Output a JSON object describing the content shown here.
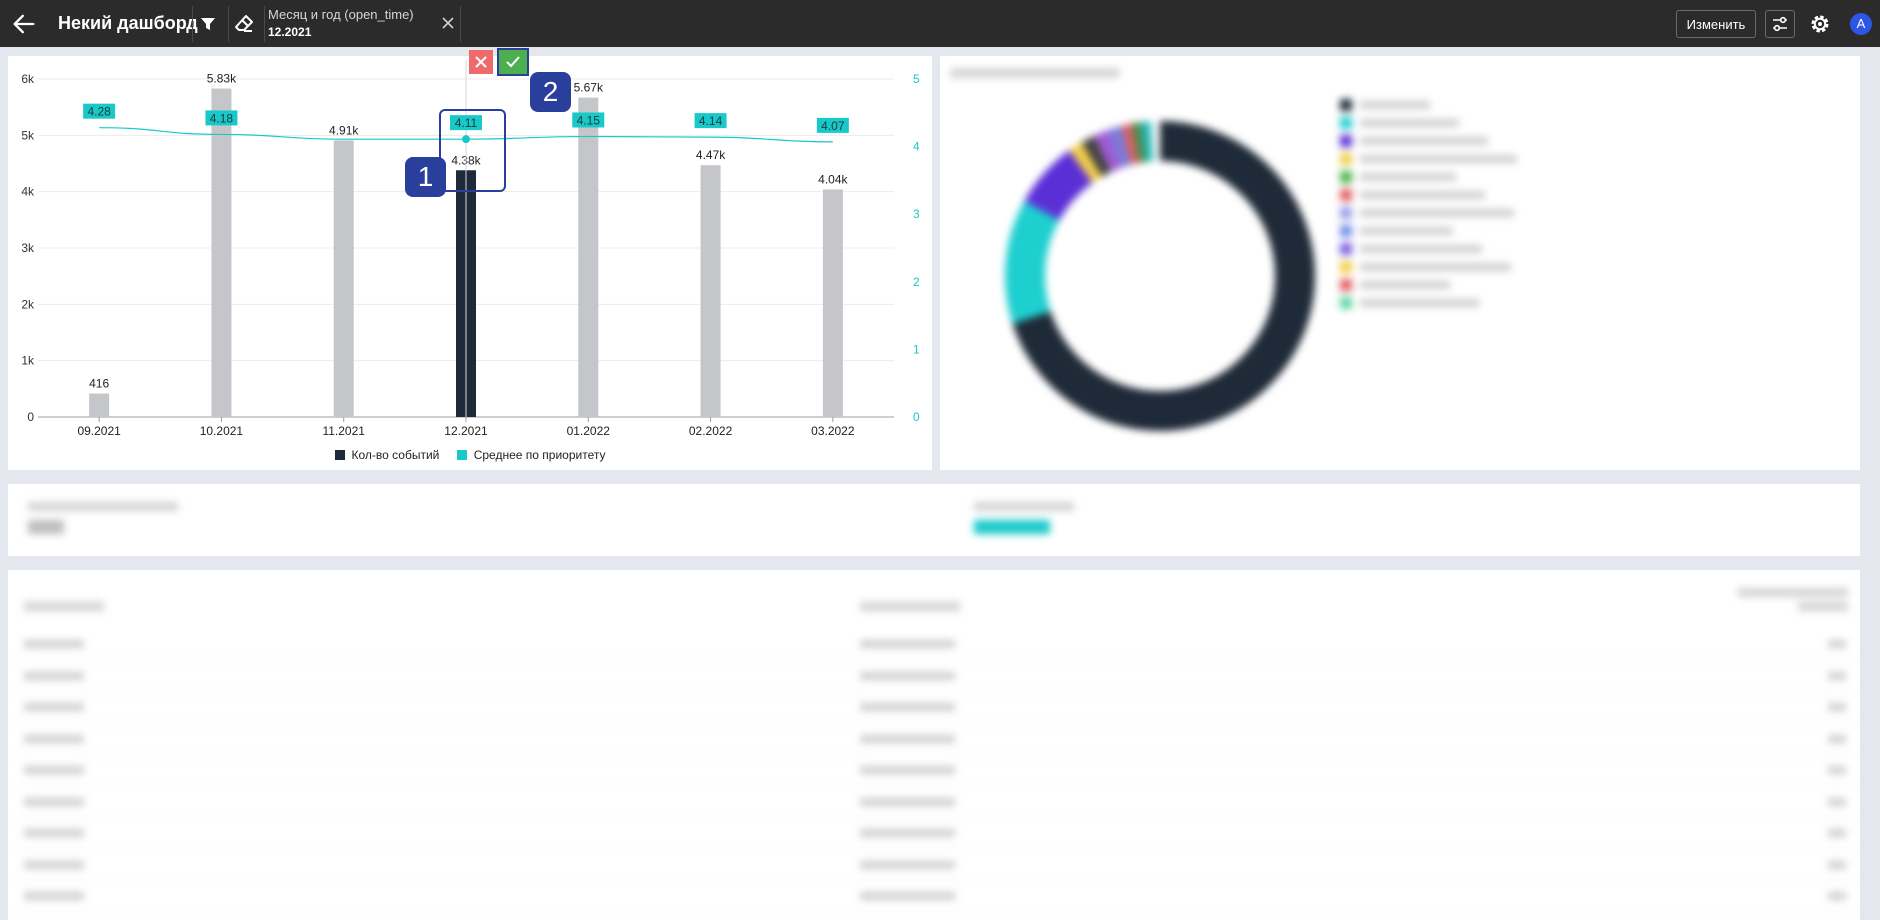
{
  "header": {
    "dashboard_title": "Некий дашборд",
    "filter": {
      "name": "Месяц и год (open_time)",
      "value": "12.2021"
    },
    "edit_label": "Изменить",
    "avatar_letter": "A"
  },
  "chart_data": {
    "type": "bar",
    "categories": [
      "09.2021",
      "10.2021",
      "11.2021",
      "12.2021",
      "01.2022",
      "02.2022",
      "03.2022"
    ],
    "series": [
      {
        "name": "Кол-во событий",
        "type": "bar",
        "values": [
          416,
          5830,
          4910,
          4380,
          5670,
          4470,
          4040
        ],
        "labels": [
          "416",
          "5.83k",
          "4.91k",
          "4.38k",
          "5.67k",
          "4.47k",
          "4.04k"
        ],
        "selected_index": 3,
        "color": "#1e2a3a",
        "muted_color": "#c4c6ca"
      },
      {
        "name": "Среднее по приоритету",
        "type": "line",
        "values": [
          4.28,
          4.18,
          4.11,
          4.11,
          4.15,
          4.14,
          4.07
        ],
        "labels": [
          "4.28",
          "4.18",
          "",
          "4.11",
          "4.15",
          "4.14",
          "4.07"
        ],
        "color": "#19c9c9"
      }
    ],
    "y_left": {
      "ticks": [
        "0",
        "1k",
        "2k",
        "3k",
        "4k",
        "5k",
        "6k"
      ],
      "range": [
        0,
        6000
      ]
    },
    "y_right": {
      "ticks": [
        "0",
        "1",
        "2",
        "3",
        "4",
        "5"
      ],
      "range": [
        0,
        5
      ]
    },
    "grid": true,
    "legend_position": "bottom"
  },
  "selection_controls": {
    "cancel_icon": "close-icon",
    "confirm_icon": "check-icon"
  },
  "annotations": {
    "callout_1": "1",
    "callout_2": "2"
  },
  "donut": {
    "slices": [
      {
        "color": "#1f2a38",
        "fraction": 0.7
      },
      {
        "color": "#1ecfd0",
        "fraction": 0.13
      },
      {
        "color": "#5b2fd6",
        "fraction": 0.07
      },
      {
        "color": "#f2d04a",
        "fraction": 0.015
      },
      {
        "color": "#444444",
        "fraction": 0.015
      },
      {
        "color": "#a05bd6",
        "fraction": 0.015
      },
      {
        "color": "#7a7ad6",
        "fraction": 0.015
      },
      {
        "color": "#e35c5c",
        "fraction": 0.01
      },
      {
        "color": "#4a8a4a",
        "fraction": 0.01
      },
      {
        "color": "#22b8b8",
        "fraction": 0.01
      }
    ],
    "legend_colors": [
      "#1f2a38",
      "#1ecfd0",
      "#5b2fd6",
      "#f2d04a",
      "#49b34a",
      "#e35c5c",
      "#9b9be8",
      "#6f8de8",
      "#7b5be0",
      "#f2d04a",
      "#e35c5c",
      "#5cd6a0"
    ]
  },
  "colors": {
    "accent": "#19c9c9",
    "dark": "#1e2a3a",
    "confirm": "#4caf50",
    "cancel": "#ef6b6b",
    "callout": "#2a3f9c"
  }
}
